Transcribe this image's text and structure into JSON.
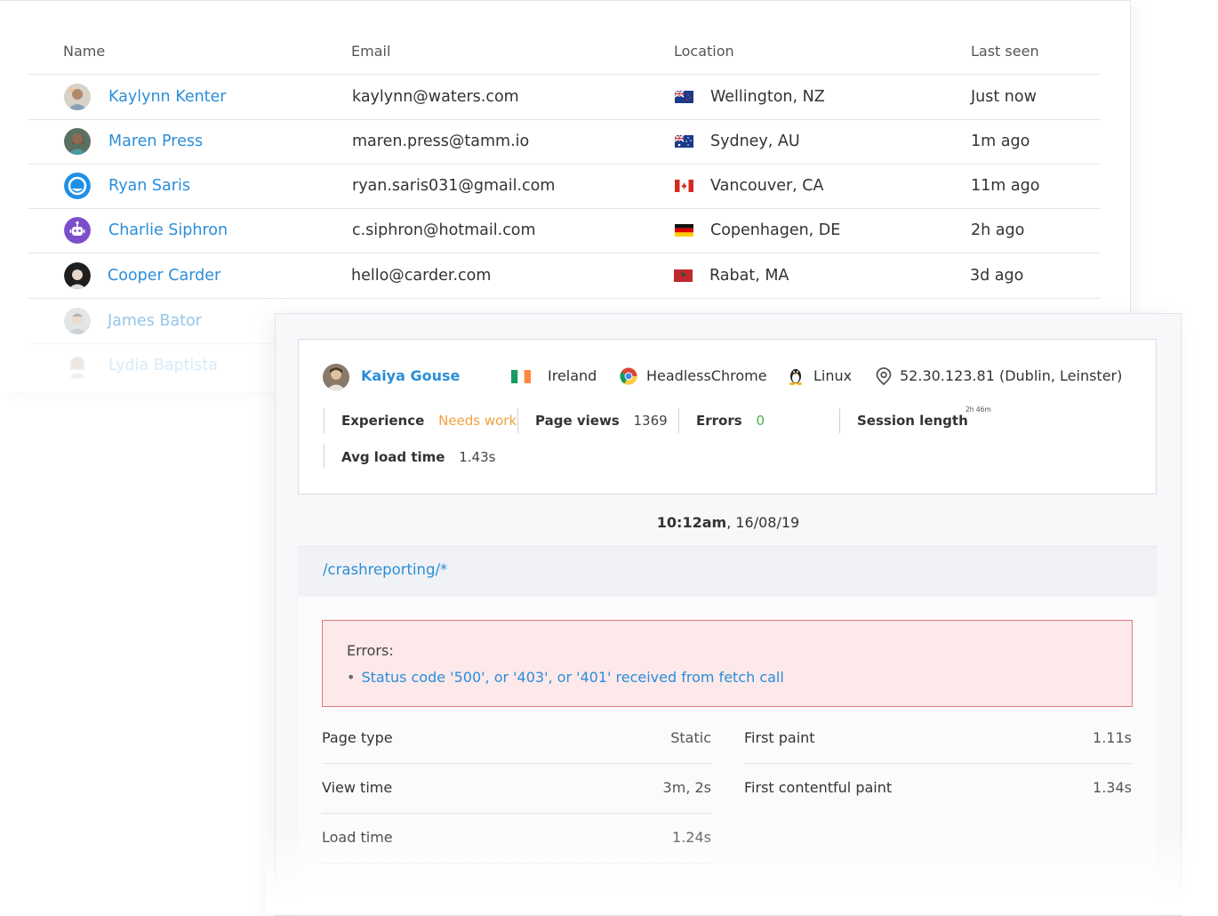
{
  "table": {
    "headers": {
      "name": "Name",
      "email": "Email",
      "location": "Location",
      "last_seen": "Last seen"
    },
    "rows": [
      {
        "name": "Kaylynn Kenter",
        "email": "kaylynn@waters.com",
        "location": "Wellington, NZ",
        "last_seen": "Just now"
      },
      {
        "name": "Maren Press",
        "email": "maren.press@tamm.io",
        "location": "Sydney, AU",
        "last_seen": "1m ago"
      },
      {
        "name": "Ryan Saris",
        "email": "ryan.saris031@gmail.com",
        "location": "Vancouver, CA",
        "last_seen": "11m ago"
      },
      {
        "name": "Charlie Siphron",
        "email": "c.siphron@hotmail.com",
        "location": "Copenhagen, DE",
        "last_seen": "2h ago"
      },
      {
        "name": "Cooper Carder",
        "email": "hello@carder.com",
        "location": "Rabat, MA",
        "last_seen": "3d ago"
      },
      {
        "name": "James Bator"
      },
      {
        "name": "Lydia Baptista"
      }
    ]
  },
  "session": {
    "user_name": "Kaiya Gouse",
    "country": "Ireland",
    "browser": "HeadlessChrome",
    "os": "Linux",
    "ip": "52.30.123.81 (Dublin, Leinster)",
    "metrics": {
      "experience_label": "Experience",
      "experience_value": "Needs work",
      "page_views_label": "Page views",
      "page_views_value": "1369",
      "errors_label": "Errors",
      "errors_value": "0",
      "session_length_label": "Session length",
      "session_length_value": "2h 46m",
      "avg_load_label": "Avg load time",
      "avg_load_value": "1.43s"
    },
    "timestamp_time": "10:12am",
    "timestamp_date": ", 16/08/19",
    "url": "/crashreporting/*",
    "errors_title": "Errors:",
    "error_items": [
      "Status code '500', or '403', or '401' received from fetch call"
    ],
    "details_left": [
      {
        "label": "Page type",
        "value": "Static"
      },
      {
        "label": "View time",
        "value": "3m, 2s"
      },
      {
        "label": "Load time",
        "value": "1.24s"
      }
    ],
    "details_right": [
      {
        "label": "First paint",
        "value": "1.11s"
      },
      {
        "label": "First contentful paint",
        "value": "1.34s"
      }
    ]
  },
  "colors": {
    "link": "#2b8ed8",
    "warning": "#f0a040",
    "success": "#4caf50",
    "error_bg": "#fde8ea",
    "error_border": "#e07a7a"
  }
}
